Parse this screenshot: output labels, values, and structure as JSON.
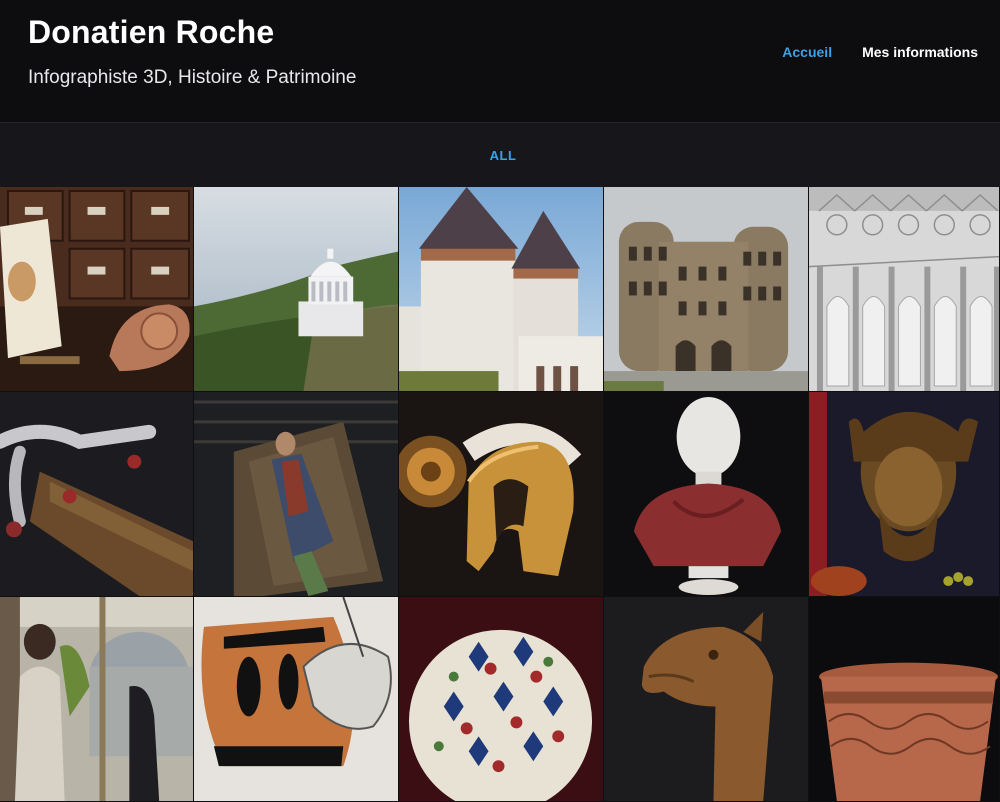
{
  "site": {
    "title": "Donatien Roche",
    "subtitle": "Infographiste 3D, Histoire & Patrimoine"
  },
  "nav": {
    "items": [
      {
        "label": "Accueil",
        "active": true
      },
      {
        "label": "Mes informations",
        "active": false
      }
    ]
  },
  "filters": {
    "items": [
      {
        "label": "ALL"
      }
    ]
  },
  "colors": {
    "accent": "#3aa2e8",
    "background": "#0f0f12",
    "header": "#0d0d10",
    "filter_bar": "#17171b"
  },
  "gallery": {
    "tiles": [
      {
        "subject": "roman-oil-lamp"
      },
      {
        "subject": "hilltop-monument"
      },
      {
        "subject": "medieval-castle"
      },
      {
        "subject": "porta-nigra"
      },
      {
        "subject": "gothic-facade"
      },
      {
        "subject": "ornate-sword-scabbard"
      },
      {
        "subject": "burial-figure"
      },
      {
        "subject": "bronze-helmet"
      },
      {
        "subject": "marble-bust"
      },
      {
        "subject": "bronze-head"
      },
      {
        "subject": "scholar-scene"
      },
      {
        "subject": "greek-vase"
      },
      {
        "subject": "mosaic-sphere"
      },
      {
        "subject": "dragon-head"
      },
      {
        "subject": "terra-sigillata-bowl"
      }
    ]
  }
}
